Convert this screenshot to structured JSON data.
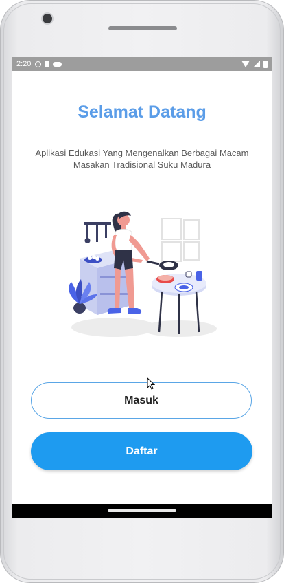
{
  "status_bar": {
    "time": "2:20",
    "left_icons": [
      "vpn-globe-icon",
      "sim-card-icon",
      "cloud-icon"
    ],
    "right_icons": [
      "wifi-icon",
      "signal-icon",
      "battery-icon"
    ]
  },
  "welcome": {
    "title": "Selamat Datang",
    "subtitle": "Aplikasi Edukasi Yang Mengenalkan Berbagai Macam Masakan Tradisional Suku Madura"
  },
  "illustration": {
    "icon": "woman-cooking-illustration"
  },
  "actions": {
    "login_label": "Masuk",
    "register_label": "Daftar"
  },
  "colors": {
    "title": "#5b9de8",
    "primary": "#1e9bf0",
    "outline": "#5aa6e6"
  }
}
